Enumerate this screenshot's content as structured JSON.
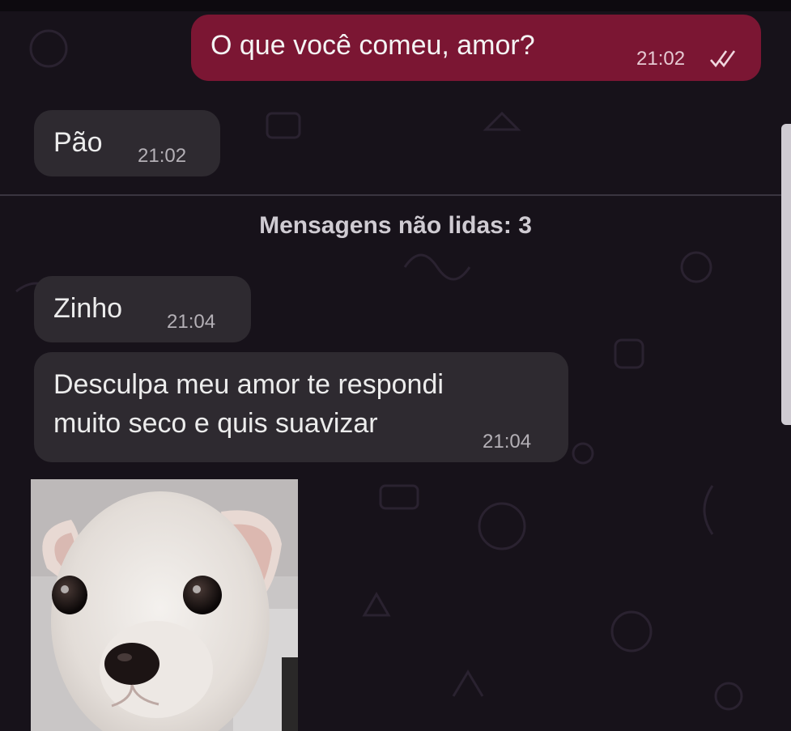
{
  "chat": {
    "messages": [
      {
        "direction": "outgoing",
        "text": "O que você comeu, amor?",
        "time": "21:02",
        "status": "read"
      },
      {
        "direction": "incoming",
        "text": "Pão",
        "time": "21:02"
      },
      {
        "direction": "incoming",
        "text": "Zinho",
        "time": "21:04"
      },
      {
        "direction": "incoming",
        "text": "Desculpa meu amor te respondi\nmuito seco e quis suavizar",
        "time": "21:04"
      }
    ],
    "unread_divider": "Mensagens não lidas: 3",
    "sticker": {
      "subject": "white-puppy"
    }
  },
  "colors": {
    "background": "#17121a",
    "outgoing_bubble": "#7b1633",
    "incoming_bubble": "#2e2a30"
  },
  "icons": {
    "read_status": "double-check-icon"
  }
}
